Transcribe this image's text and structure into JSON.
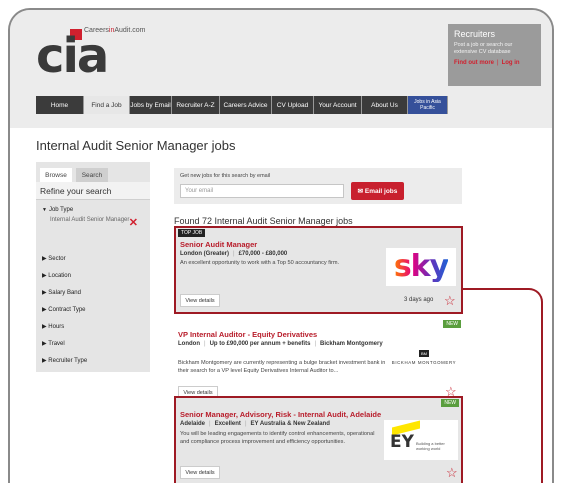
{
  "header": {
    "site_name_prefix": "Careers",
    "site_name_mid": "in",
    "site_name_suffix": "Audit.com",
    "logo_text": "cia"
  },
  "recruiters": {
    "title": "Recruiters",
    "text": "Post a job or search our extensive CV database",
    "find_out_more": "Find out more",
    "login": "Log in"
  },
  "nav": [
    {
      "label": "Home"
    },
    {
      "label": "Find a Job"
    },
    {
      "label": "Jobs by Email"
    },
    {
      "label": "Recruiter A-Z"
    },
    {
      "label": "Careers Advice"
    },
    {
      "label": "CV Upload"
    },
    {
      "label": "Your Account"
    },
    {
      "label": "About Us"
    },
    {
      "label_line1": "Jobs in Asia",
      "label_line2": "Pacific"
    }
  ],
  "page_title": "Internal Audit Senior Manager jobs",
  "sidebar": {
    "tab_browse": "Browse",
    "tab_search": "Search",
    "refine_title": "Refine your search",
    "job_type_label": "Job Type",
    "job_type_value": "Internal Audit Senior Manager",
    "filters": [
      "Sector",
      "Location",
      "Salary Band",
      "Contract Type",
      "Hours",
      "Travel",
      "Recruiter Type"
    ]
  },
  "email_alert": {
    "label": "Get new jobs for this search by email",
    "placeholder": "Your email",
    "button": "Email jobs"
  },
  "results_count_text": "Found 72 Internal Audit Senior Manager jobs",
  "jobs": [
    {
      "badge": "TOP JOB",
      "title": "Senior Audit Manager",
      "location": "London (Greater)",
      "salary": "£70,000 - £80,000",
      "description": "An excellent opportunity to work with a Top 50 accountancy firm.",
      "logo": "sky",
      "posted": "3 days ago",
      "view_label": "View details"
    },
    {
      "badge": "NEW",
      "title": "VP Internal Auditor - Equity Derivatives",
      "location": "London",
      "salary": "Up to £90,000 per annum + benefits",
      "company": "Bickham Montgomery",
      "description": "Bickham Montgomery are currently representing a bulge bracket investment bank in their search for a VP level Equity Derivatives Internal Auditor to...",
      "logo_mark": "BM",
      "logo_name": "BICKHAM MONTGOMERY",
      "view_label": "View details"
    },
    {
      "badge": "NEW",
      "title": "Senior Manager, Advisory, Risk - Internal Audit, Adelaide",
      "location": "Adelaide",
      "salary": "Excellent",
      "company": "EY Australia & New Zealand",
      "description": "You will be leading engagements to identify control enhancements, operational and compliance process improvement and efficiency opportunities.",
      "logo_mark": "EY",
      "logo_tag": "Building a better working world",
      "view_label": "View details"
    }
  ],
  "colors": {
    "brand_red": "#c8202e",
    "nav_dark": "#3b3b3b",
    "nav_asia": "#35509a",
    "highlight_border": "#9e1a24",
    "new_badge": "#5a9e3e"
  }
}
